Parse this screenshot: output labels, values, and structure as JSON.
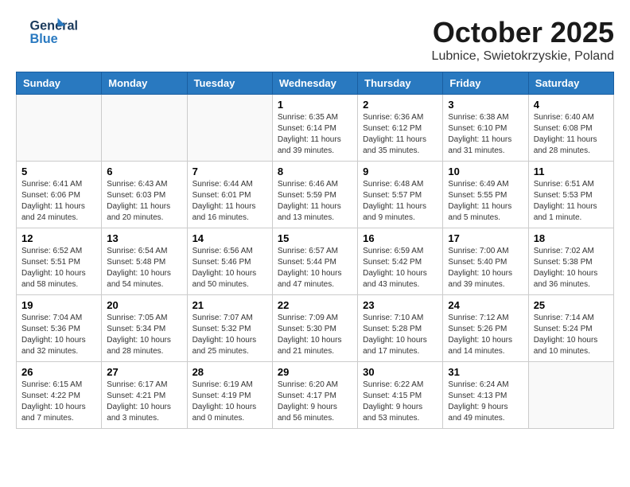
{
  "header": {
    "logo_line1": "General",
    "logo_line2": "Blue",
    "month": "October 2025",
    "location": "Lubnice, Swietokrzyskie, Poland"
  },
  "days_of_week": [
    "Sunday",
    "Monday",
    "Tuesday",
    "Wednesday",
    "Thursday",
    "Friday",
    "Saturday"
  ],
  "weeks": [
    [
      {
        "day": "",
        "info": ""
      },
      {
        "day": "",
        "info": ""
      },
      {
        "day": "",
        "info": ""
      },
      {
        "day": "1",
        "info": "Sunrise: 6:35 AM\nSunset: 6:14 PM\nDaylight: 11 hours\nand 39 minutes."
      },
      {
        "day": "2",
        "info": "Sunrise: 6:36 AM\nSunset: 6:12 PM\nDaylight: 11 hours\nand 35 minutes."
      },
      {
        "day": "3",
        "info": "Sunrise: 6:38 AM\nSunset: 6:10 PM\nDaylight: 11 hours\nand 31 minutes."
      },
      {
        "day": "4",
        "info": "Sunrise: 6:40 AM\nSunset: 6:08 PM\nDaylight: 11 hours\nand 28 minutes."
      }
    ],
    [
      {
        "day": "5",
        "info": "Sunrise: 6:41 AM\nSunset: 6:06 PM\nDaylight: 11 hours\nand 24 minutes."
      },
      {
        "day": "6",
        "info": "Sunrise: 6:43 AM\nSunset: 6:03 PM\nDaylight: 11 hours\nand 20 minutes."
      },
      {
        "day": "7",
        "info": "Sunrise: 6:44 AM\nSunset: 6:01 PM\nDaylight: 11 hours\nand 16 minutes."
      },
      {
        "day": "8",
        "info": "Sunrise: 6:46 AM\nSunset: 5:59 PM\nDaylight: 11 hours\nand 13 minutes."
      },
      {
        "day": "9",
        "info": "Sunrise: 6:48 AM\nSunset: 5:57 PM\nDaylight: 11 hours\nand 9 minutes."
      },
      {
        "day": "10",
        "info": "Sunrise: 6:49 AM\nSunset: 5:55 PM\nDaylight: 11 hours\nand 5 minutes."
      },
      {
        "day": "11",
        "info": "Sunrise: 6:51 AM\nSunset: 5:53 PM\nDaylight: 11 hours\nand 1 minute."
      }
    ],
    [
      {
        "day": "12",
        "info": "Sunrise: 6:52 AM\nSunset: 5:51 PM\nDaylight: 10 hours\nand 58 minutes."
      },
      {
        "day": "13",
        "info": "Sunrise: 6:54 AM\nSunset: 5:48 PM\nDaylight: 10 hours\nand 54 minutes."
      },
      {
        "day": "14",
        "info": "Sunrise: 6:56 AM\nSunset: 5:46 PM\nDaylight: 10 hours\nand 50 minutes."
      },
      {
        "day": "15",
        "info": "Sunrise: 6:57 AM\nSunset: 5:44 PM\nDaylight: 10 hours\nand 47 minutes."
      },
      {
        "day": "16",
        "info": "Sunrise: 6:59 AM\nSunset: 5:42 PM\nDaylight: 10 hours\nand 43 minutes."
      },
      {
        "day": "17",
        "info": "Sunrise: 7:00 AM\nSunset: 5:40 PM\nDaylight: 10 hours\nand 39 minutes."
      },
      {
        "day": "18",
        "info": "Sunrise: 7:02 AM\nSunset: 5:38 PM\nDaylight: 10 hours\nand 36 minutes."
      }
    ],
    [
      {
        "day": "19",
        "info": "Sunrise: 7:04 AM\nSunset: 5:36 PM\nDaylight: 10 hours\nand 32 minutes."
      },
      {
        "day": "20",
        "info": "Sunrise: 7:05 AM\nSunset: 5:34 PM\nDaylight: 10 hours\nand 28 minutes."
      },
      {
        "day": "21",
        "info": "Sunrise: 7:07 AM\nSunset: 5:32 PM\nDaylight: 10 hours\nand 25 minutes."
      },
      {
        "day": "22",
        "info": "Sunrise: 7:09 AM\nSunset: 5:30 PM\nDaylight: 10 hours\nand 21 minutes."
      },
      {
        "day": "23",
        "info": "Sunrise: 7:10 AM\nSunset: 5:28 PM\nDaylight: 10 hours\nand 17 minutes."
      },
      {
        "day": "24",
        "info": "Sunrise: 7:12 AM\nSunset: 5:26 PM\nDaylight: 10 hours\nand 14 minutes."
      },
      {
        "day": "25",
        "info": "Sunrise: 7:14 AM\nSunset: 5:24 PM\nDaylight: 10 hours\nand 10 minutes."
      }
    ],
    [
      {
        "day": "26",
        "info": "Sunrise: 6:15 AM\nSunset: 4:22 PM\nDaylight: 10 hours\nand 7 minutes."
      },
      {
        "day": "27",
        "info": "Sunrise: 6:17 AM\nSunset: 4:21 PM\nDaylight: 10 hours\nand 3 minutes."
      },
      {
        "day": "28",
        "info": "Sunrise: 6:19 AM\nSunset: 4:19 PM\nDaylight: 10 hours\nand 0 minutes."
      },
      {
        "day": "29",
        "info": "Sunrise: 6:20 AM\nSunset: 4:17 PM\nDaylight: 9 hours\nand 56 minutes."
      },
      {
        "day": "30",
        "info": "Sunrise: 6:22 AM\nSunset: 4:15 PM\nDaylight: 9 hours\nand 53 minutes."
      },
      {
        "day": "31",
        "info": "Sunrise: 6:24 AM\nSunset: 4:13 PM\nDaylight: 9 hours\nand 49 minutes."
      },
      {
        "day": "",
        "info": ""
      }
    ]
  ]
}
